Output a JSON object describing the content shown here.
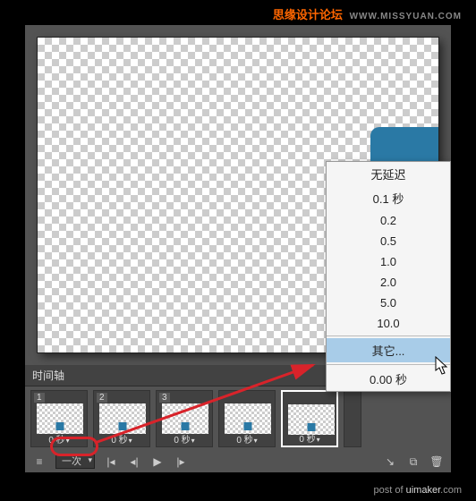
{
  "watermark": {
    "top_main": "思缘设计论坛",
    "top_sub": "WWW.MISSYUAN.COM",
    "bottom_prefix": "post of ",
    "bottom_site": "uimaker",
    "bottom_suffix": ".com"
  },
  "timeline": {
    "header": "时间轴",
    "loop": "一次",
    "frames": [
      {
        "num": "1",
        "delay": "0 秒"
      },
      {
        "num": "2",
        "delay": "0 秒"
      },
      {
        "num": "3",
        "delay": "0 秒"
      },
      {
        "num": "",
        "delay": "0 秒"
      },
      {
        "num": "",
        "delay": "0 秒"
      }
    ]
  },
  "menu": {
    "items": [
      "无延迟",
      "0.1 秒",
      "0.2",
      "0.5",
      "1.0",
      "2.0",
      "5.0",
      "10.0"
    ],
    "other": "其它...",
    "current": "0.00 秒"
  }
}
